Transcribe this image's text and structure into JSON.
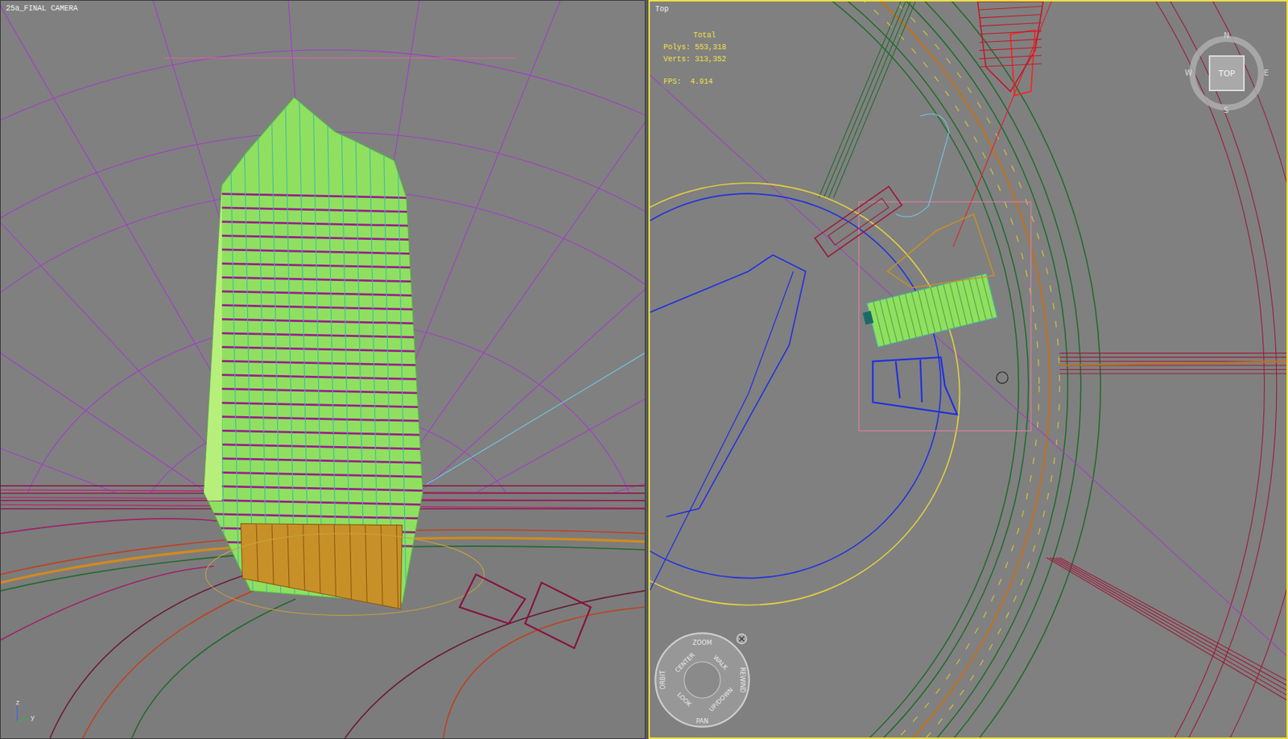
{
  "viewports": [
    {
      "label": "25a_FINAL CAMERA",
      "active": false
    },
    {
      "label": "Top",
      "active": true
    }
  ],
  "stats": {
    "title": "Total",
    "polys": "Polys: 553,318",
    "verts": "Verts: 313,352",
    "fps": "FPS:  4.914"
  },
  "viewcube": {
    "face": "TOP",
    "compass": [
      "N",
      "W",
      "E",
      "S"
    ]
  },
  "nav_wheel": {
    "items": [
      "ZOOM",
      "ORBIT",
      "CENTER",
      "WALK",
      "REWIND",
      "LOOK",
      "UP/DOWN",
      "PAN"
    ]
  },
  "axis": [
    "z",
    "y"
  ]
}
